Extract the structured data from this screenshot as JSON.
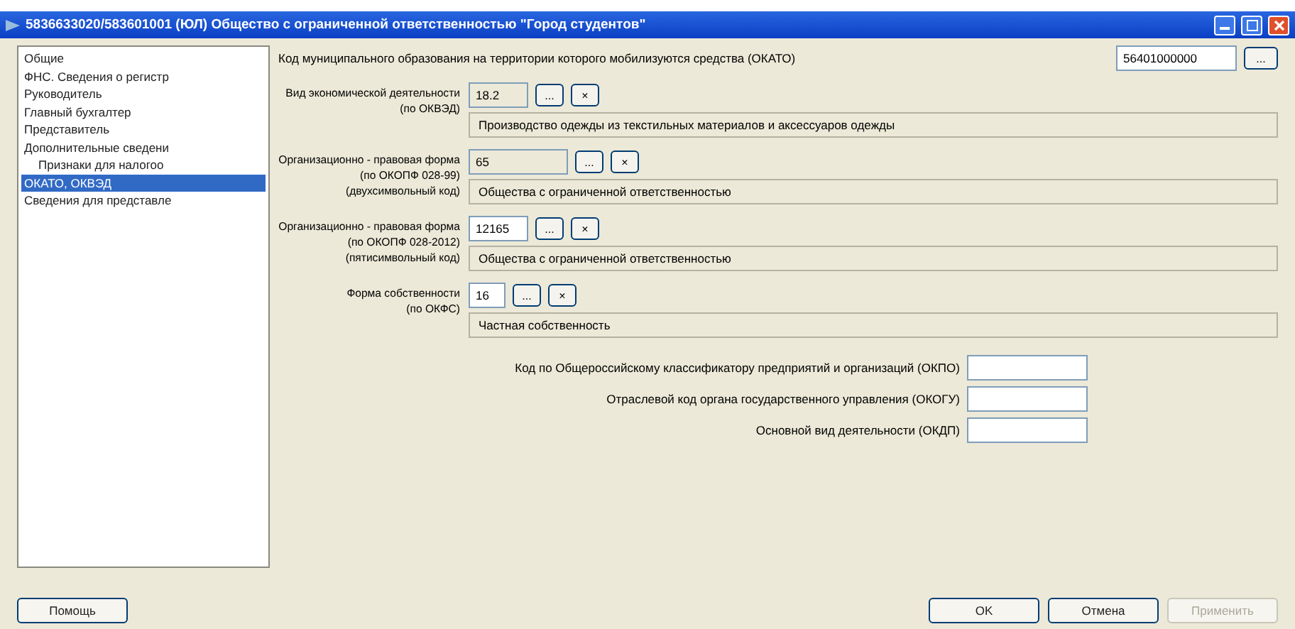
{
  "window": {
    "title": "5836633020/583601001 (ЮЛ) Общество с ограниченной ответственностью \"Город студентов\""
  },
  "sidebar": {
    "items": [
      {
        "label": "Общие",
        "selected": false
      },
      {
        "label": "ФНС. Сведения о регистр",
        "selected": false
      },
      {
        "label": "Руководитель",
        "selected": false
      },
      {
        "label": "Главный бухгалтер",
        "selected": false
      },
      {
        "label": "Представитель",
        "selected": false
      },
      {
        "label": "Дополнительные сведени",
        "selected": false,
        "children": [
          {
            "label": "Признаки для налогоо",
            "selected": false
          }
        ]
      },
      {
        "label": "ОКАТО, ОКВЭД",
        "selected": true
      },
      {
        "label": "Сведения для представле",
        "selected": false
      }
    ]
  },
  "okato": {
    "label": "Код муниципального образования на территории которого мобилизуются средства (ОКАТО)",
    "value": "56401000000",
    "pick": "..."
  },
  "classifiers": [
    {
      "label_lines": [
        "Вид экономической деятельности",
        "(по ОКВЭД)"
      ],
      "code": "18.2",
      "description": "Производство одежды из текстильных материалов и аксессуаров одежды"
    },
    {
      "label_lines": [
        "Организационно - правовая форма",
        "(по ОКОПФ 028-99)",
        "(двухсимвольный код)"
      ],
      "code": "65",
      "description": "Общества с ограниченной ответственностью"
    },
    {
      "label_lines": [
        "Организационно - правовая форма",
        "(по ОКОПФ 028-2012)",
        "(пятисимвольный код)"
      ],
      "code": "12165",
      "description": "Общества с ограниченной ответственностью"
    },
    {
      "label_lines": [
        "Форма собственности",
        "(по ОКФС)"
      ],
      "code": "16",
      "description": "Частная собственность"
    }
  ],
  "codes": [
    {
      "label": "Код по Общероссийскому классификатору предприятий и организаций (ОКПО)"
    },
    {
      "label": "Отраслевой код органа государственного управления (ОКОГУ)"
    },
    {
      "label": "Основной вид деятельности (ОКДП)"
    }
  ],
  "pick_label": "...",
  "clear_label": "×",
  "help_button": {
    "label": "Помощь"
  },
  "buttons": [
    {
      "label": "OK",
      "disabled": false
    },
    {
      "label": "Отмена",
      "disabled": false
    },
    {
      "label": "Применить",
      "disabled": true
    }
  ]
}
